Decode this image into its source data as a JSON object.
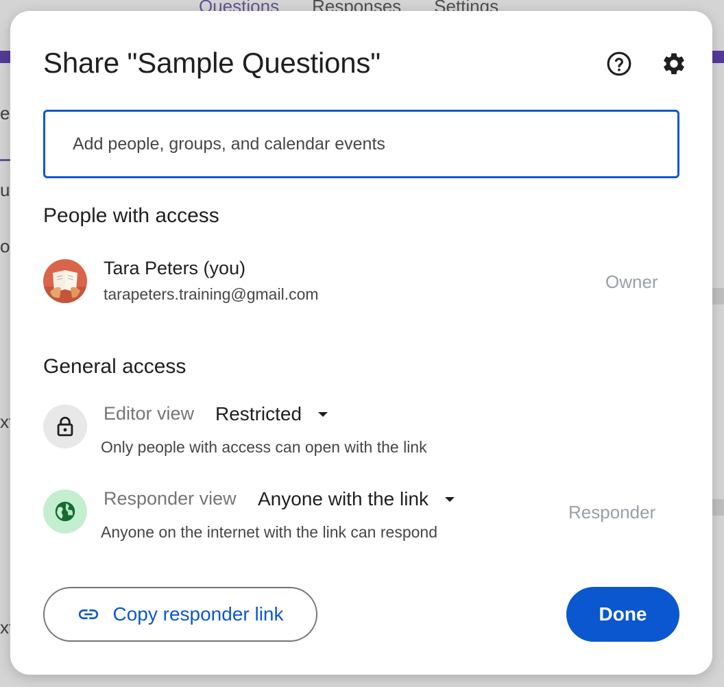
{
  "background": {
    "tabs": [
      "Questions",
      "Responses",
      "Settings"
    ],
    "fragments": [
      "e",
      "u",
      "ou",
      "xt",
      "xt"
    ]
  },
  "dialog": {
    "title": "Share \"Sample Questions\"",
    "help_icon": "help-circle-icon",
    "settings_icon": "gear-icon",
    "add_people": {
      "placeholder": "Add people, groups, and calendar events",
      "value": ""
    },
    "people_section": {
      "heading": "People with access",
      "people": [
        {
          "name": "Tara Peters (you)",
          "email": "tarapeters.training@gmail.com",
          "role": "Owner"
        }
      ]
    },
    "general_access": {
      "heading": "General access",
      "editor": {
        "label": "Editor view",
        "value": "Restricted",
        "description": "Only people with access can open with the link",
        "icon": "lock-icon"
      },
      "responder": {
        "label": "Responder view",
        "value": "Anyone with the link",
        "description": "Anyone on the internet with the link can respond",
        "role": "Responder",
        "icon": "globe-icon"
      }
    },
    "copy_link_label": "Copy responder link",
    "done_label": "Done"
  },
  "colors": {
    "accent": "#0b57d0",
    "globe_bg": "#c4eed0",
    "globe_fg": "#146c2e",
    "muted": "#9aa0a6"
  }
}
